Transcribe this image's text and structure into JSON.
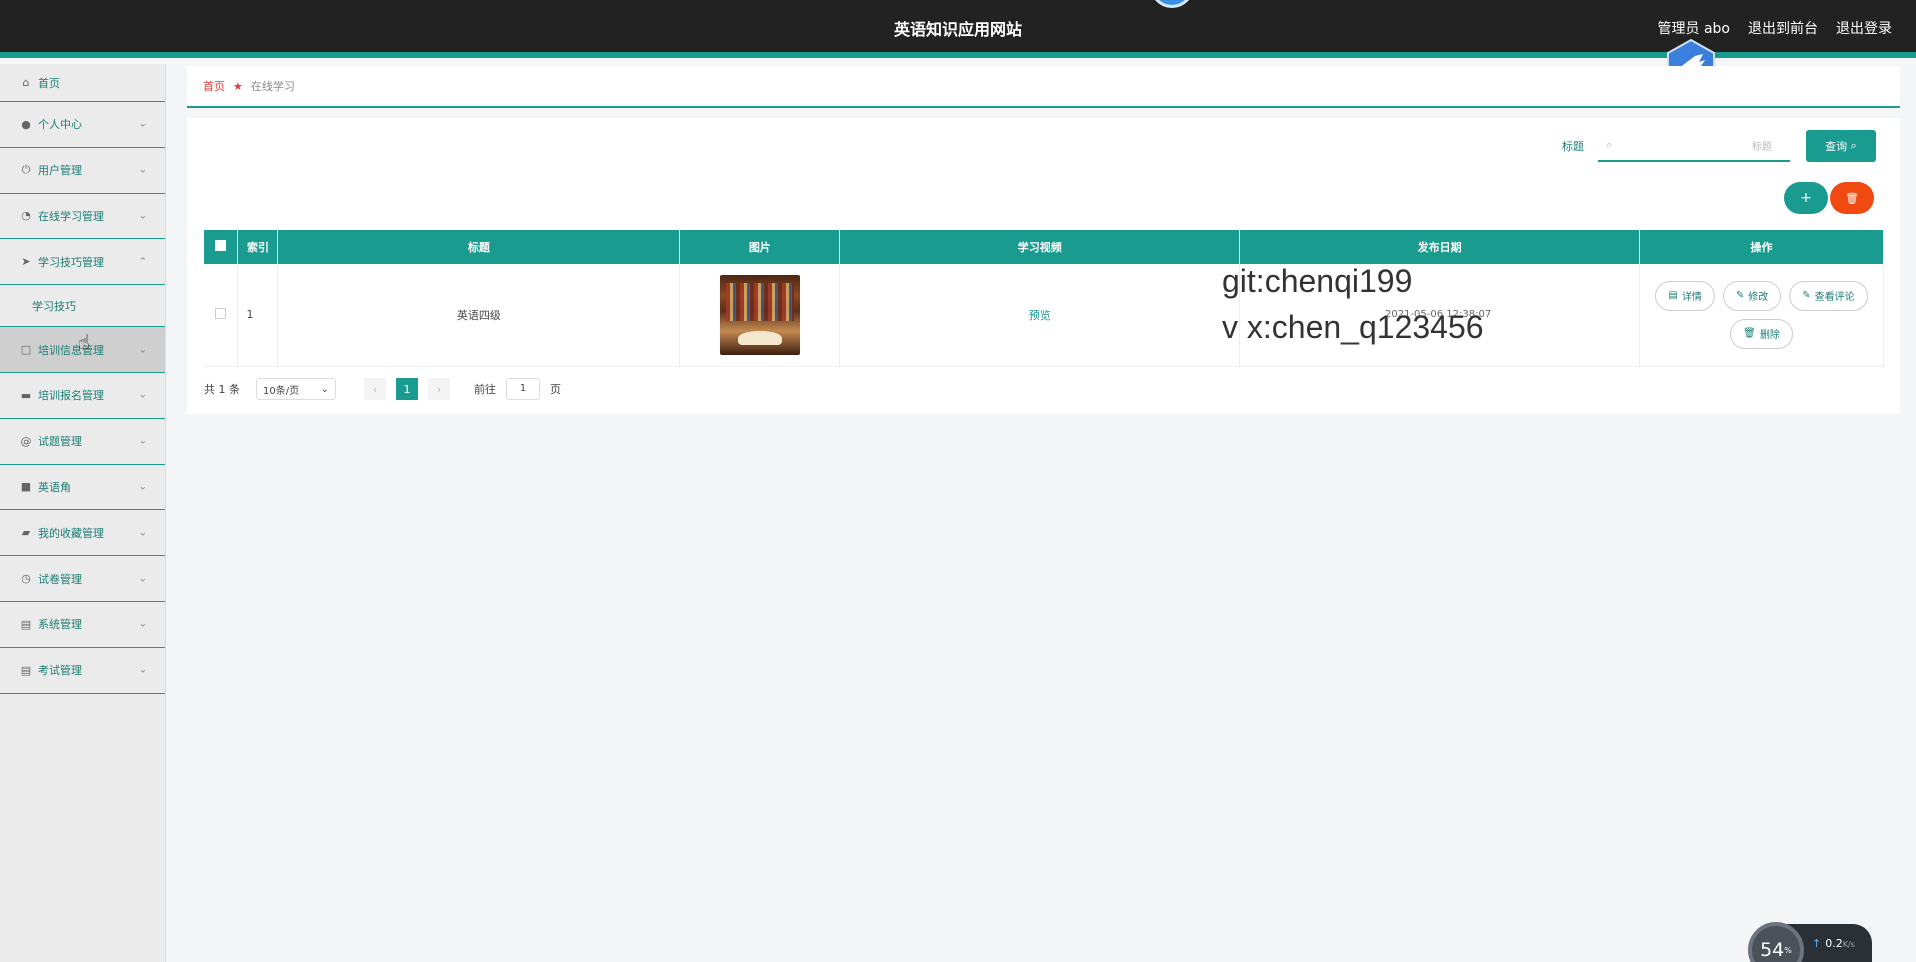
{
  "header": {
    "site_title": "英语知识应用网站",
    "admin_label": "管理员 abo",
    "to_front": "退出到前台",
    "logout": "退出登录"
  },
  "sidebar": {
    "home": "首页",
    "items": [
      {
        "label": "个人中心",
        "icon": "user-icon"
      },
      {
        "label": "用户管理",
        "icon": "power-icon"
      },
      {
        "label": "在线学习管理",
        "icon": "gauge-icon"
      },
      {
        "label": "学习技巧管理",
        "icon": "paper-plane-icon"
      },
      {
        "label": "培训信息管理",
        "icon": "square-icon"
      },
      {
        "label": "培训报名管理",
        "icon": "chat-icon"
      },
      {
        "label": "试题管理",
        "icon": "at-icon"
      },
      {
        "label": "英语角",
        "icon": "briefcase-icon"
      },
      {
        "label": "我的收藏管理",
        "icon": "folder-icon"
      },
      {
        "label": "试卷管理",
        "icon": "clock-icon"
      },
      {
        "label": "系统管理",
        "icon": "clipboard-icon"
      },
      {
        "label": "考试管理",
        "icon": "clipboard-icon"
      }
    ],
    "sub_item": "学习技巧"
  },
  "breadcrumb": {
    "home": "首页",
    "current": "在线学习"
  },
  "search": {
    "label": "标题",
    "placeholder": "标题",
    "button": "查询"
  },
  "table": {
    "headers": [
      "索引",
      "标题",
      "图片",
      "学习视频",
      "发布日期",
      "操作"
    ],
    "rows": [
      {
        "index": "1",
        "title": "英语四级",
        "video": "预览",
        "date": "2021-05-06 12:38:07",
        "ops": [
          "详情",
          "修改",
          "查看评论",
          "删除"
        ]
      }
    ]
  },
  "pager": {
    "total": "共 1 条",
    "page_size": "10条/页",
    "current": "1",
    "goto_label": "前往",
    "goto_value": "1",
    "page_unit": "页"
  },
  "watermark": {
    "line1": "git:chenqi199",
    "line2": "v x:chen_q123456"
  },
  "speed": {
    "percent": "54",
    "rate": "0.2",
    "unit": "K/s"
  },
  "colors": {
    "accent": "#1a9b8f",
    "danger": "#f04a12",
    "header_bg": "#222222"
  }
}
